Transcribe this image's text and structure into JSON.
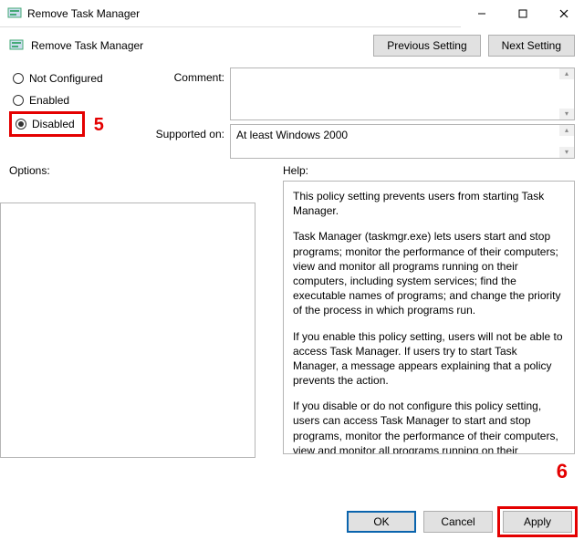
{
  "window": {
    "title": "Remove Task Manager",
    "subtitle": "Remove Task Manager"
  },
  "nav": {
    "prev": "Previous Setting",
    "next": "Next Setting"
  },
  "radios": {
    "not_configured": "Not Configured",
    "enabled": "Enabled",
    "disabled": "Disabled"
  },
  "labels": {
    "comment": "Comment:",
    "supported": "Supported on:",
    "options": "Options:",
    "help": "Help:"
  },
  "fields": {
    "comment_value": "",
    "supported_value": "At least Windows 2000"
  },
  "help_paragraphs": [
    "This policy setting prevents users from starting Task Manager.",
    "Task Manager (taskmgr.exe) lets users start and stop programs; monitor the performance of their computers; view and monitor all programs running on their computers, including system services; find the executable names of programs; and change the priority of the process in which programs run.",
    "If you enable this policy setting, users will not be able to access Task Manager. If users try to start Task Manager, a message appears explaining that a policy prevents the action.",
    "If you disable or do not configure this policy setting, users can access Task Manager to  start and stop programs, monitor the performance of their computers, view and monitor all programs running on their computers, including system services, find the executable names of programs, and change the priority of the process in which programs run."
  ],
  "footer": {
    "ok": "OK",
    "cancel": "Cancel",
    "apply": "Apply"
  },
  "annotations": {
    "five": "5",
    "six": "6"
  }
}
